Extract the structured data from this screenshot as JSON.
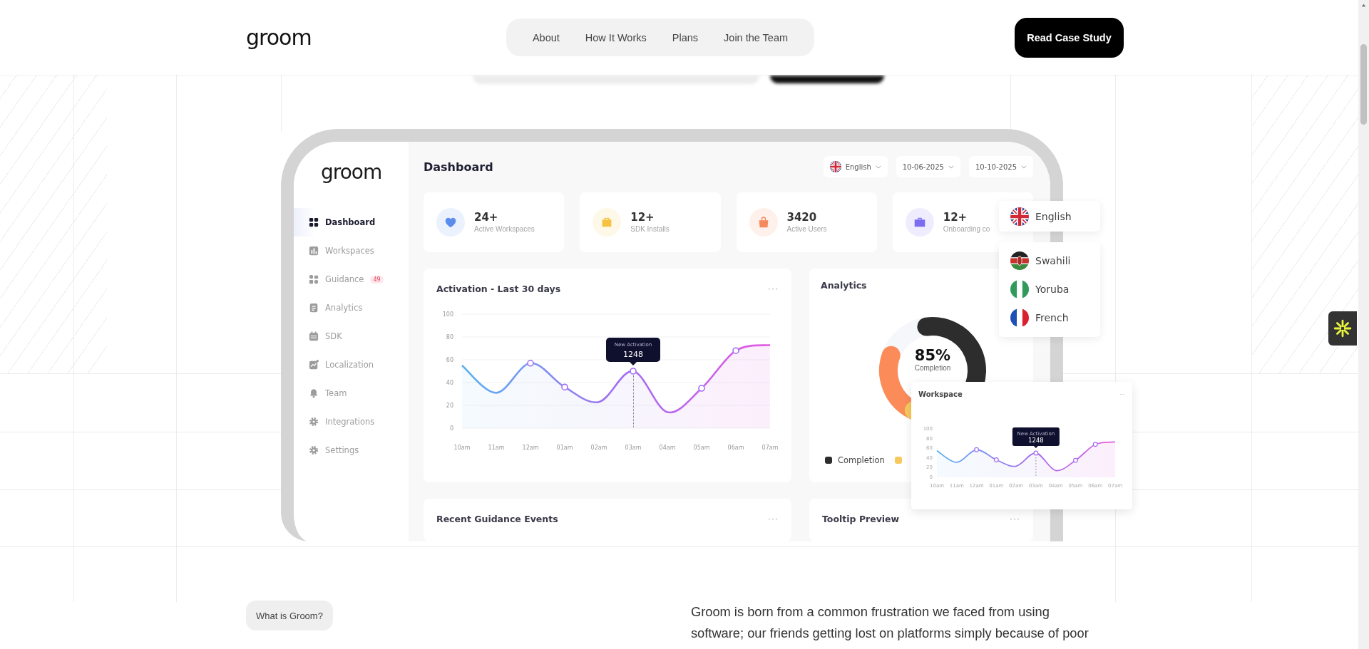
{
  "header": {
    "logo": "groom",
    "nav": [
      {
        "label": "About"
      },
      {
        "label": "How It Works"
      },
      {
        "label": "Plans"
      },
      {
        "label": "Join the Team"
      }
    ],
    "cta": "Read Case Study"
  },
  "dashboard": {
    "logo": "groom",
    "sidebar": [
      {
        "label": "Dashboard",
        "selected": true
      },
      {
        "label": "Workspaces",
        "selected": false
      },
      {
        "label": "Guidance",
        "badge": "49",
        "selected": false
      },
      {
        "label": "Analytics",
        "selected": false
      },
      {
        "label": "SDK",
        "selected": false
      },
      {
        "label": "Localization",
        "selected": false
      },
      {
        "label": "Team",
        "selected": false
      },
      {
        "label": "Integrations",
        "selected": false
      },
      {
        "label": "Settings",
        "selected": false
      }
    ],
    "title": "Dashboard",
    "filters": [
      {
        "kind": "language",
        "label": "English"
      },
      {
        "kind": "date",
        "label": "10-06-2025"
      },
      {
        "kind": "date",
        "label": "10-10-2025"
      }
    ],
    "stats": [
      {
        "value": "24+",
        "label": "Active Workspaces",
        "color": "#5b8def"
      },
      {
        "value": "12+",
        "label": "SDK Installs",
        "color": "#f5c242"
      },
      {
        "value": "3420",
        "label": "Active Users",
        "color": "#f5895c"
      },
      {
        "value": "12+",
        "label": "Onboarding co",
        "color": "#7b6cf0"
      }
    ],
    "activation": {
      "menu": "···",
      "chart_data": {
        "type": "area",
        "title": "Activation - Last 30 days",
        "categories": [
          "10am",
          "11am",
          "12am",
          "01am",
          "02am",
          "03am",
          "04am",
          "05am",
          "06am",
          "07am"
        ],
        "ylim": [
          0,
          100
        ],
        "yticks": [
          0,
          20,
          40,
          60,
          80,
          100
        ],
        "grid": true,
        "series": [
          {
            "color": "#a16ef2",
            "values": [
              55,
              31,
              57,
              36,
              23,
              50,
              14,
              35,
              68,
              73
            ]
          }
        ],
        "annotations": [
          "New Activation",
          "1248"
        ]
      }
    },
    "analytics": {
      "title": "Analytics",
      "center_value": "85%",
      "center_label": "Completion",
      "legend": [
        {
          "label": "Completion",
          "color": "#2d2d2d"
        },
        {
          "color": "#f7c85c"
        }
      ]
    },
    "guidance_events": {
      "title": "Recent Guidance Events",
      "menu": "···"
    },
    "tooltip_preview": {
      "title": "Tooltip Preview",
      "menu": "···"
    },
    "language_menu": {
      "current": {
        "label": "English"
      },
      "options": [
        {
          "label": "Swahili"
        },
        {
          "label": "Yoruba"
        },
        {
          "label": "French"
        }
      ]
    },
    "workspace_card": {
      "menu": "···",
      "chart_data": {
        "type": "area",
        "title": "Workspace",
        "categories": [
          "10am",
          "11am",
          "12am",
          "01am",
          "02am",
          "03am",
          "04am",
          "05am",
          "06am",
          "07am"
        ],
        "ylim": [
          0,
          100
        ],
        "yticks": [
          0,
          20,
          40,
          60,
          80,
          100
        ],
        "series": [
          {
            "color": "#a16ef2",
            "values": [
              55,
              31,
              57,
              36,
              23,
              50,
              14,
              35,
              68,
              73
            ]
          }
        ],
        "annotations": [
          "New Activation",
          "1248"
        ]
      }
    }
  },
  "about": {
    "tag": "What is Groom?",
    "text": "Groom is born from a common frustration we faced from using software; our friends getting lost on platforms simply because of poor"
  }
}
